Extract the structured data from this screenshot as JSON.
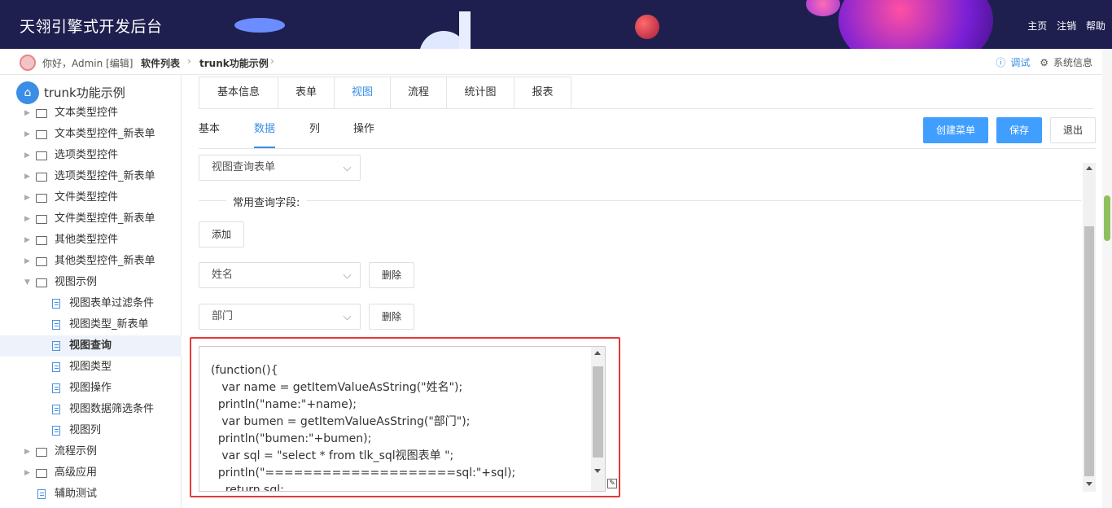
{
  "header": {
    "brand": "天翎引擎式开发后台",
    "links": [
      "主页",
      "注销",
      "帮助"
    ]
  },
  "breadcrumb": {
    "greeting": "你好，Admin [编辑]",
    "items": [
      "软件列表",
      "trunk功能示例"
    ],
    "tools": {
      "debug": "调试",
      "sysinfo": "系统信息"
    }
  },
  "sidebar": {
    "root": "trunk功能示例",
    "items": [
      "文本类型控件",
      "文本类型控件_新表单",
      "选项类型控件",
      "选项类型控件_新表单",
      "文件类型控件",
      "文件类型控件_新表单",
      "其他类型控件",
      "其他类型控件_新表单",
      "视图示例",
      "视图表单过滤条件",
      "视图类型_新表单",
      "视图查询",
      "视图类型",
      "视图操作",
      "视图数据筛选条件",
      "视图列",
      "流程示例",
      "高级应用",
      "辅助测试"
    ]
  },
  "tabs": [
    "基本信息",
    "表单",
    "视图",
    "流程",
    "统计图",
    "报表"
  ],
  "subtabs": [
    "基本",
    "数据",
    "列",
    "操作"
  ],
  "buttons": {
    "create_menu": "创建菜单",
    "save": "保存",
    "exit": "退出"
  },
  "form": {
    "query_form": "视图查询表单",
    "section_label": "常用查询字段:",
    "add": "添加",
    "field1": "姓名",
    "field2": "部门",
    "delete": "删除",
    "code_lines": [
      "(function(){",
      "   var name = getItemValueAsString(\"姓名\");",
      "  println(\"name:\"+name);",
      "   var bumen = getItemValueAsString(\"部门\");",
      "  println(\"bumen:\"+bumen);",
      "   var sql = \"select * from tlk_sql视图表单 \";",
      "  println(\"====================sql:\"+sql);",
      "    return sql;",
      "   })()"
    ]
  },
  "colors": {
    "accent": "#409eff",
    "header": "#1e1f4f",
    "highlight": "#e53935"
  }
}
